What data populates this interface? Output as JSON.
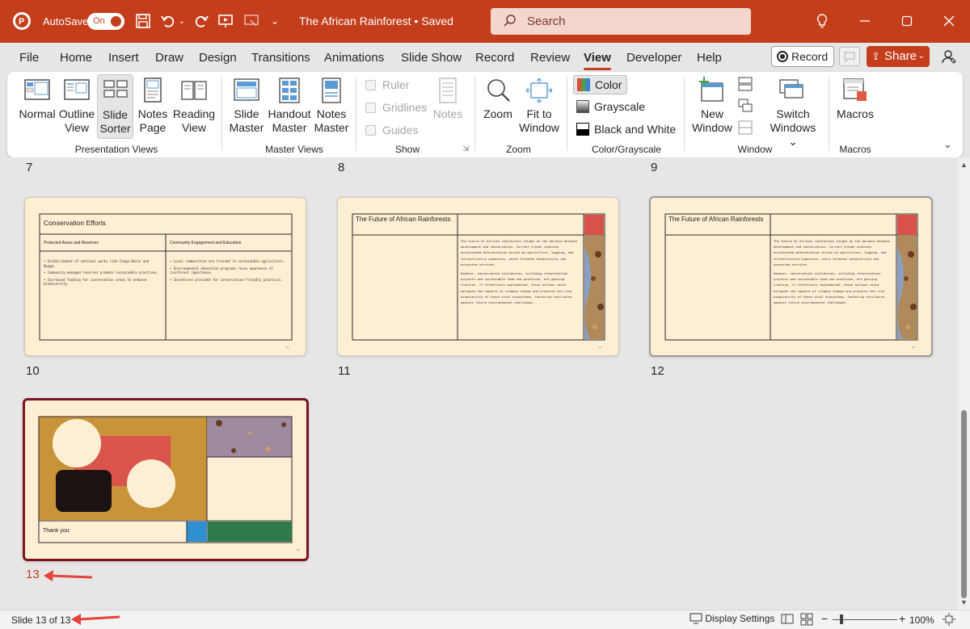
{
  "titlebar": {
    "autosave_label": "AutoSave",
    "autosave_state": "On",
    "doc_title": "The African Rainforest • Saved",
    "search_placeholder": "Search",
    "accent": "#c43e1c"
  },
  "tabs": [
    "File",
    "Home",
    "Insert",
    "Draw",
    "Design",
    "Transitions",
    "Animations",
    "Slide Show",
    "Record",
    "Review",
    "View",
    "Developer",
    "Help"
  ],
  "active_tab": "View",
  "right_buttons": {
    "record": "Record",
    "share": "Share"
  },
  "ribbon": {
    "presentation_views": {
      "label": "Presentation Views",
      "normal": "Normal",
      "outline": [
        "Outline",
        "View"
      ],
      "slide_sorter": [
        "Slide",
        "Sorter"
      ],
      "notes_page": [
        "Notes",
        "Page"
      ],
      "reading_view": [
        "Reading",
        "View"
      ]
    },
    "master_views": {
      "label": "Master Views",
      "slide_master": [
        "Slide",
        "Master"
      ],
      "handout_master": [
        "Handout",
        "Master"
      ],
      "notes_master": [
        "Notes",
        "Master"
      ]
    },
    "show": {
      "label": "Show",
      "ruler": "Ruler",
      "gridlines": "Gridlines",
      "guides": "Guides",
      "notes": "Notes"
    },
    "zoom": {
      "label": "Zoom",
      "zoom": "Zoom",
      "fit": [
        "Fit to",
        "Window"
      ]
    },
    "color": {
      "label": "Color/Grayscale",
      "color": "Color",
      "grayscale": "Grayscale",
      "bw": "Black and White"
    },
    "window": {
      "label": "Window",
      "new_window": [
        "New",
        "Window"
      ],
      "switch": [
        "Switch",
        "Windows ⌄"
      ]
    },
    "macros": {
      "label": "Macros",
      "macros": "Macros"
    }
  },
  "slides": {
    "row_labels_top": [
      "7",
      "8",
      "9"
    ],
    "labels": [
      "10",
      "11",
      "12",
      "13"
    ],
    "slide10": {
      "title": "Conservation Efforts",
      "col1_head": "Protected Areas and Reserves",
      "col2_head": "Community Engagement and Education",
      "col1_items": [
        "Establishment of national parks like Congo Basin and Nyaga.",
        "Community-managed reserves promote sustainable practices.",
        "Increased funding for conservation areas to enhance biodiversity."
      ],
      "col2_items": [
        "Local communities are trained in sustainable agriculture.",
        "Environmental education programs raise awareness of rainforest importance.",
        "Incentives provided for conservation-friendly practices."
      ],
      "num": "10"
    },
    "slide11": {
      "title": "The Future of African Rainforests",
      "p1": "The future of African rainforests hinges on the balance between development and conservation. Current trends indicate accelerated deforestation driven by agriculture, logging, and infrastructure expansion, which threaten biodiversity and ecosystem services.",
      "p2": "However, conservation initiatives, including reforestation projects and sustainable land-use practices, are gaining traction. If effectively implemented, these actions could mitigate the impacts of climate change and preserve the rich biodiversity of these vital ecosystems, fostering resilience against future environmental challenges.",
      "num": "11"
    },
    "slide12": {
      "num": "12"
    },
    "slide13": {
      "text": "Thank you",
      "num": "13"
    }
  },
  "status": {
    "slide_info": "Slide 13 of 13",
    "display_settings": "Display Settings",
    "zoom": "100%"
  }
}
